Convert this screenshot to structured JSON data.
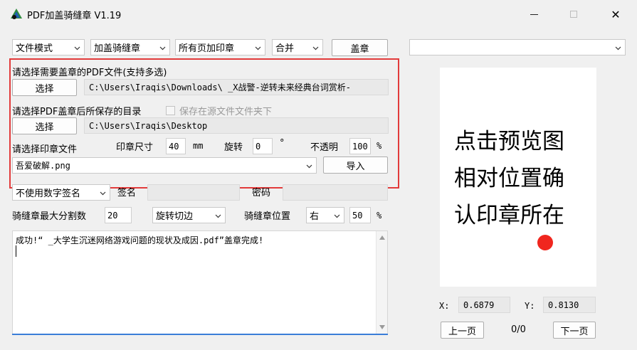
{
  "window": {
    "title": "PDF加盖骑缝章 V1.19",
    "close_glyph": "✕"
  },
  "toolbar": {
    "mode_select": "文件模式",
    "stamp_type_select": "加盖骑缝章",
    "page_select": "所有页加印章",
    "merge_select": "合并",
    "stamp_button": "盖章"
  },
  "input_section": {
    "pdf_label": "请选择需要盖章的PDF文件(支持多选)",
    "pdf_select_button": "选择",
    "pdf_path": "C:\\Users\\Iraqis\\Downloads\\  _X战警-逆转未来经典台词赏析-",
    "output_label": "请选择PDF盖章后所保存的目录",
    "save_in_source_label": "保存在源文件文件夹下",
    "save_in_source_checked": false,
    "output_select_button": "选择",
    "output_path": "C:\\Users\\Iraqis\\Desktop",
    "stamp_file_label": "请选择印章文件",
    "stamp_size_label": "印章尺寸",
    "stamp_size_value": "40",
    "stamp_size_unit": "mm",
    "rotate_label": "旋转",
    "rotate_value": "0",
    "rotate_unit": "°",
    "opacity_label": "不透明",
    "opacity_value": "100",
    "opacity_unit": "%",
    "stamp_file_select": "吾爱破解.png",
    "import_button": "导入"
  },
  "signature_row": {
    "signature_select": "不使用数字签名",
    "sign_label": "签名",
    "sign_value": "",
    "password_label": "密码",
    "password_value": ""
  },
  "seam_row": {
    "max_split_label": "骑缝章最大分割数",
    "max_split_value": "20",
    "cut_select": "旋转切边",
    "position_label": "骑缝章位置",
    "position_select": "右",
    "position_value": "50",
    "position_unit": "%"
  },
  "log": {
    "text": "成功!“  _大学生沉迷网络游戏问题的现状及成因.pdf”盖章完成!"
  },
  "preview": {
    "file_select": "",
    "hint_lines": [
      "点击预览图",
      "相对位置确",
      "认印章所在"
    ],
    "x_label": "X:",
    "x_value": "0.6879",
    "y_label": "Y:",
    "y_value": "0.8130",
    "prev_button": "上一页",
    "page_counter": "0/0",
    "next_button": "下一页"
  },
  "colors": {
    "highlight_box": "#e23b3b",
    "marker": "#f0261e",
    "log_accent": "#3a7dd8"
  }
}
